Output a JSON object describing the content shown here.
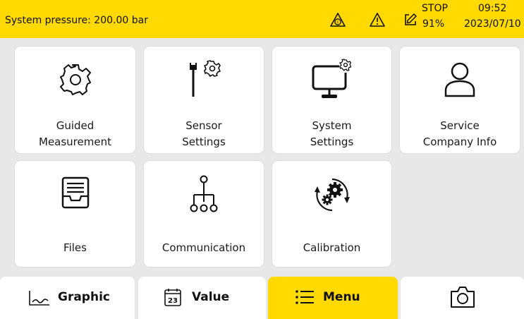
{
  "status": {
    "pressure_text": "System pressure: 200.00 bar",
    "mode": "STOP",
    "battery": "91%",
    "time": "09:52",
    "date": "2023/07/10",
    "icons": [
      "calibration-warning-icon",
      "warning-icon",
      "edit-icon"
    ]
  },
  "tiles": [
    {
      "line1": "Guided",
      "line2": "Measurement",
      "icon": "gear-icon"
    },
    {
      "line1": "Sensor",
      "line2": "Settings",
      "icon": "sensor-settings-icon"
    },
    {
      "line1": "System",
      "line2": "Settings",
      "icon": "system-settings-icon"
    },
    {
      "line1": "Service",
      "line2": "Company Info",
      "icon": "user-icon"
    },
    {
      "line1": "Files",
      "line2": "",
      "icon": "file-tray-icon"
    },
    {
      "line1": "Communication",
      "line2": "",
      "icon": "network-icon"
    },
    {
      "line1": "Calibration",
      "line2": "",
      "icon": "calibration-icon"
    }
  ],
  "tabs": [
    {
      "label": "Graphic",
      "icon": "graph-icon",
      "active": false
    },
    {
      "label": "Value",
      "icon": "calendar-value-icon",
      "icon_text": "23",
      "active": false
    },
    {
      "label": "Menu",
      "icon": "list-icon",
      "active": true
    },
    {
      "label": "",
      "icon": "camera-icon",
      "active": false
    }
  ],
  "colors": {
    "accent": "#ffd900",
    "background": "#e8e8e8",
    "tile": "#ffffff"
  }
}
